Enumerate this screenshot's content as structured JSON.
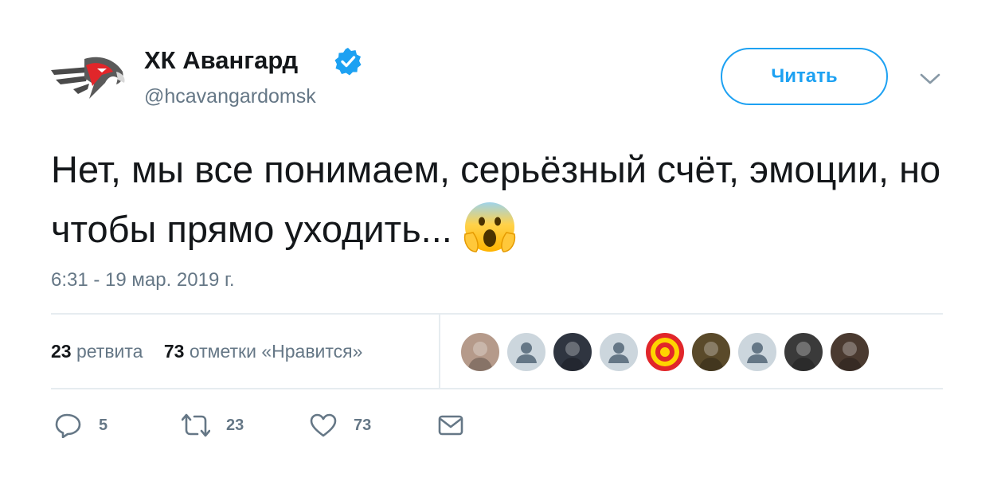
{
  "account": {
    "display_name": "ХК Авангард",
    "handle": "@hcavangardomsk",
    "verified": true,
    "avatar_icon": "eagle-logo-icon"
  },
  "follow_button": {
    "label": "Читать",
    "color": "#1da1f2"
  },
  "menu_icon": "chevron-down-icon",
  "tweet": {
    "text": "Нет, мы все понимаем, серьёзный счёт, эмоции, но чтобы прямо уходить...",
    "emoji": "screaming-face-emoji",
    "timestamp": "6:31 - 19 мар. 2019 г."
  },
  "stats": {
    "retweets_count": "23",
    "retweets_label": "ретвита",
    "likes_count": "73",
    "likes_label": "отметки «Нравится»"
  },
  "likers": [
    {
      "kind": "photo",
      "color": "#b59a8a"
    },
    {
      "kind": "default",
      "color": "#ccd6dd"
    },
    {
      "kind": "photo",
      "color": "#2f3540"
    },
    {
      "kind": "default",
      "color": "#ccd6dd"
    },
    {
      "kind": "logo",
      "color": "#e1262a"
    },
    {
      "kind": "photo",
      "color": "#5a4a2a"
    },
    {
      "kind": "default",
      "color": "#ccd6dd"
    },
    {
      "kind": "photo",
      "color": "#3a3a3a"
    },
    {
      "kind": "photo",
      "color": "#4a3a30"
    }
  ],
  "actions": {
    "reply_count": "5",
    "retweet_count": "23",
    "like_count": "73"
  },
  "colors": {
    "accent": "#1da1f2",
    "text": "#14171a",
    "secondary": "#657786",
    "divider": "#e6ecf0"
  }
}
